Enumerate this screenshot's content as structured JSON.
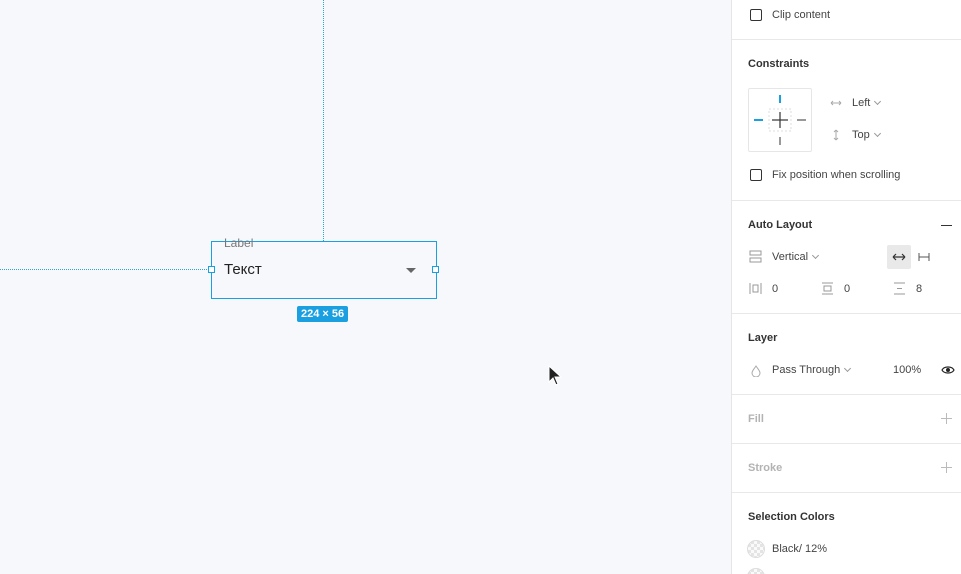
{
  "canvas": {
    "field": {
      "label": "Label",
      "value": "Текст"
    },
    "size_badge": "224 × 56"
  },
  "panel": {
    "clip_content": {
      "label": "Clip content",
      "checked": false
    },
    "constraints": {
      "title": "Constraints",
      "horizontal": "Left",
      "vertical": "Top",
      "fix_position": {
        "label": "Fix position when scrolling",
        "checked": false
      }
    },
    "auto_layout": {
      "title": "Auto Layout",
      "direction": "Vertical",
      "padding_horizontal": "0",
      "padding_vertical": "0",
      "spacing": "8"
    },
    "layer": {
      "title": "Layer",
      "blend": "Pass Through",
      "opacity": "100%"
    },
    "fill": {
      "title": "Fill"
    },
    "stroke": {
      "title": "Stroke"
    },
    "selection_colors": {
      "title": "Selection Colors",
      "items": [
        {
          "label": "Black/ 12%"
        }
      ]
    }
  },
  "colors": {
    "accent": "#1aa0e0",
    "canvas_bg": "#f7f8fb",
    "panel_bg": "#ffffff"
  }
}
